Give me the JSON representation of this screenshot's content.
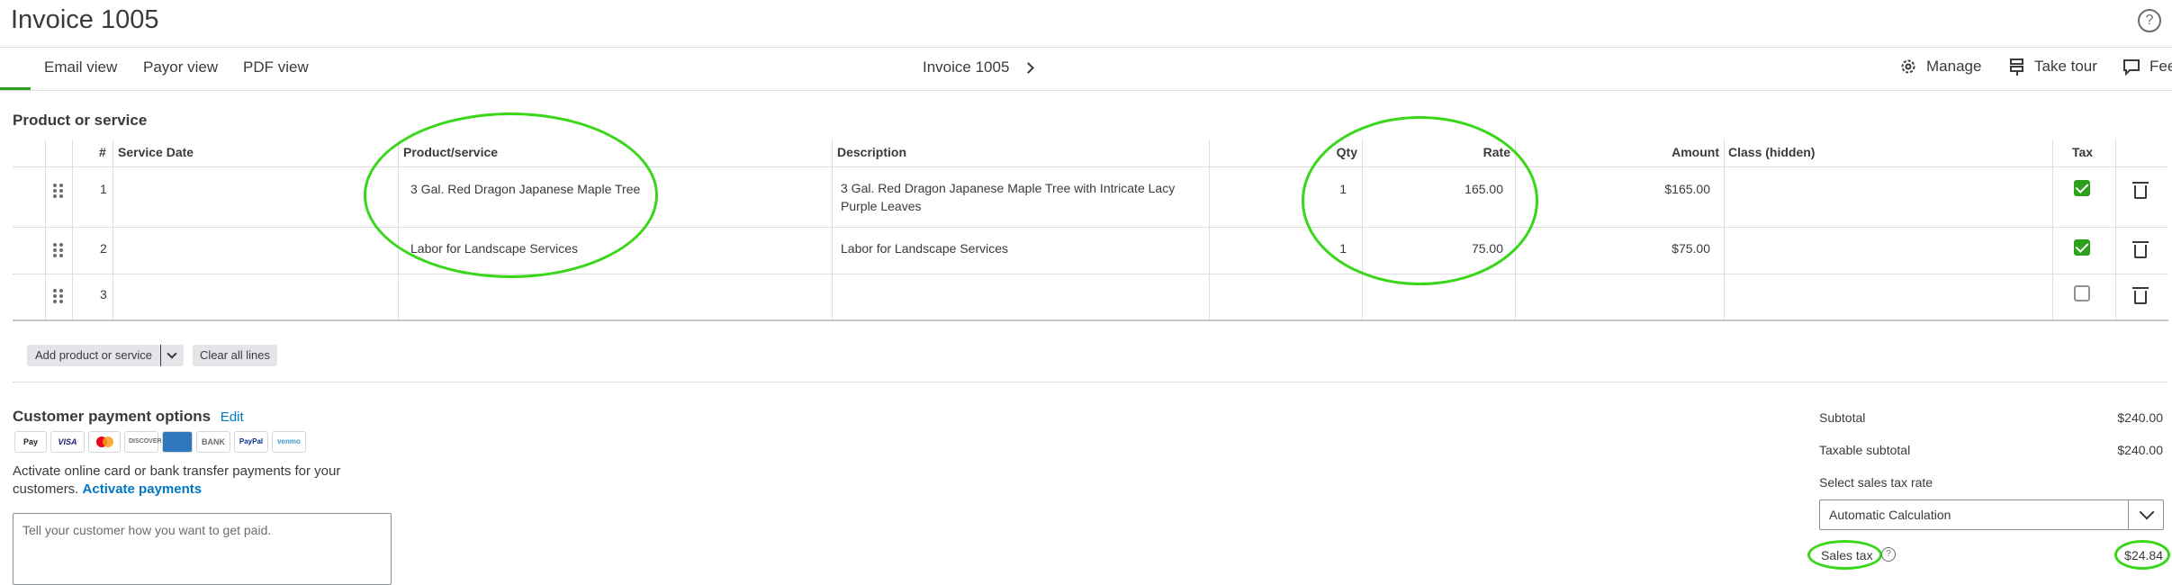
{
  "header": {
    "title": "Invoice 1005",
    "help_icon": "question-circle-icon"
  },
  "tabs": [
    {
      "label": "Email view",
      "active": true
    },
    {
      "label": "Payor view",
      "active": false
    },
    {
      "label": "PDF view",
      "active": false
    }
  ],
  "breadcrumb": {
    "label": "Invoice 1005"
  },
  "toolbar": {
    "manage": "Manage",
    "take_tour": "Take tour",
    "feedback": "Fee"
  },
  "section": {
    "title": "Product or service"
  },
  "table": {
    "columns": {
      "num": "#",
      "service_date": "Service Date",
      "product": "Product/service",
      "description": "Description",
      "qty": "Qty",
      "rate": "Rate",
      "amount": "Amount",
      "class": "Class (hidden)",
      "tax": "Tax"
    },
    "rows": [
      {
        "num": "1",
        "service_date": "",
        "product": "3 Gal. Red Dragon Japanese Maple Tree",
        "description_line1": "3 Gal. Red Dragon Japanese Maple Tree with Intricate Lacy",
        "description_line2": "Purple Leaves",
        "qty": "1",
        "rate": "165.00",
        "amount": "$165.00",
        "class": "",
        "tax": true
      },
      {
        "num": "2",
        "service_date": "",
        "product": "Labor for Landscape Services",
        "description_line1": "Labor for Landscape Services",
        "description_line2": "",
        "qty": "1",
        "rate": "75.00",
        "amount": "$75.00",
        "class": "",
        "tax": true
      },
      {
        "num": "3",
        "service_date": "",
        "product": "",
        "description_line1": "",
        "description_line2": "",
        "qty": "",
        "rate": "",
        "amount": "",
        "class": "",
        "tax": false
      }
    ]
  },
  "actions": {
    "add_line": "Add product or service",
    "clear_lines": "Clear all lines"
  },
  "payment": {
    "title": "Customer payment options",
    "edit": "Edit",
    "logos": [
      "Pay",
      "VISA",
      "",
      "DISCOVER",
      "",
      "BANK",
      "PayPal",
      "venmo"
    ],
    "text": "Activate online card or bank transfer payments for your customers.",
    "activate_link": "Activate payments",
    "message_placeholder": "Tell your customer how you want to get paid."
  },
  "totals": {
    "subtotal_label": "Subtotal",
    "subtotal_value": "$240.00",
    "taxable_label": "Taxable subtotal",
    "taxable_value": "$240.00",
    "rate_label": "Select sales tax rate",
    "rate_selected": "Automatic Calculation",
    "sales_tax_label": "Sales tax",
    "sales_tax_value": "$24.84"
  },
  "colors": {
    "accent": "#2ca01c",
    "annotation": "#39d61a",
    "link": "#0077c5"
  }
}
